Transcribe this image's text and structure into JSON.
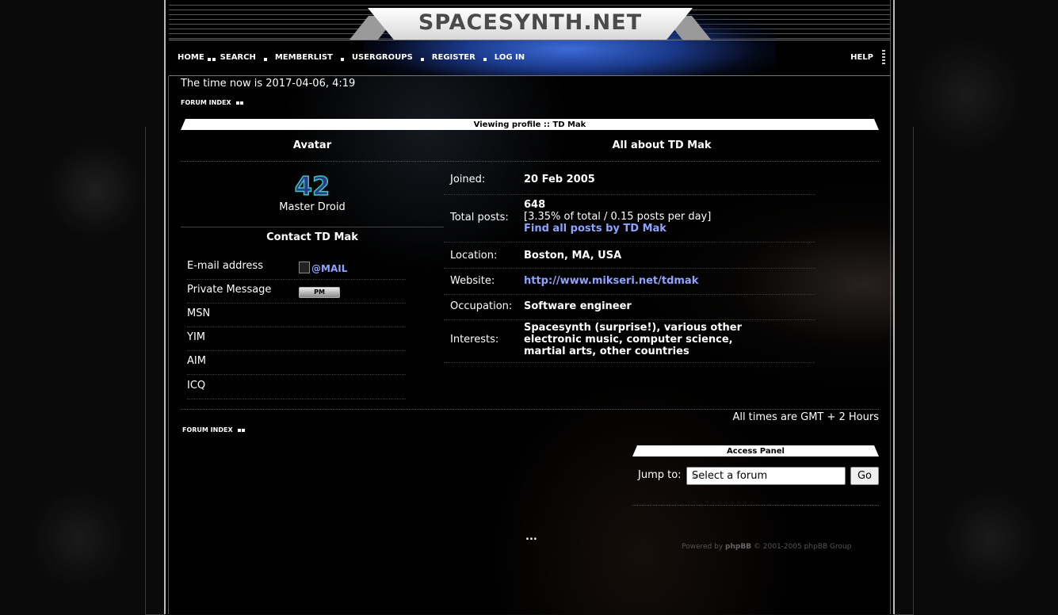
{
  "site": {
    "logo_text": "SPACESYNTH.NET"
  },
  "nav": {
    "items": [
      {
        "label": "HOME"
      },
      {
        "label": "SEARCH"
      },
      {
        "label": "MEMBERLIST"
      },
      {
        "label": "USERGROUPS"
      },
      {
        "label": "REGISTER"
      },
      {
        "label": "LOG IN"
      }
    ],
    "help": "HELP"
  },
  "time_now": "The time now is 2017-04-06, 4:19",
  "breadcrumb": "FORUM INDEX",
  "profile": {
    "heading": "Viewing profile :: TD Mak",
    "avatar_heading": "Avatar",
    "avatar_text": "42",
    "rank": "Master Droid",
    "about_heading": "All about TD Mak",
    "contact_heading": "Contact TD Mak",
    "contact": [
      {
        "label": "E-mail address",
        "value": "@MAIL"
      },
      {
        "label": "Private Message",
        "value": "PM"
      },
      {
        "label": "MSN",
        "value": ""
      },
      {
        "label": "YIM",
        "value": ""
      },
      {
        "label": "AIM",
        "value": ""
      },
      {
        "label": "ICQ",
        "value": ""
      }
    ],
    "fields": {
      "joined_label": "Joined:",
      "joined": "20 Feb 2005",
      "posts_label": "Total posts:",
      "posts": "648",
      "posts_stats": "[3.35% of total / 0.15 posts per day]",
      "find_posts": "Find all posts by TD Mak",
      "location_label": "Location:",
      "location": "Boston, MA, USA",
      "website_label": "Website:",
      "website": "http://www.mikseri.net/tdmak",
      "occupation_label": "Occupation:",
      "occupation": "Software engineer",
      "interests_label": "Interests:",
      "interests": "Spacesynth (surprise!), various other electronic music, computer science, martial arts, other countries"
    }
  },
  "timezone": "All times are GMT + 2 Hours",
  "access_panel": {
    "title": "Access Panel",
    "jump_label": "Jump to:",
    "select_value": "Select a forum",
    "go_label": "Go"
  },
  "footer": {
    "ellipsis": "...",
    "powered_prefix": "Powered by ",
    "powered_brand": "phpBB",
    "powered_suffix": " © 2001-2005 phpBB Group"
  },
  "colors": {
    "link": "#8ea3ff",
    "background": "#000000",
    "text": "#ffffff"
  }
}
